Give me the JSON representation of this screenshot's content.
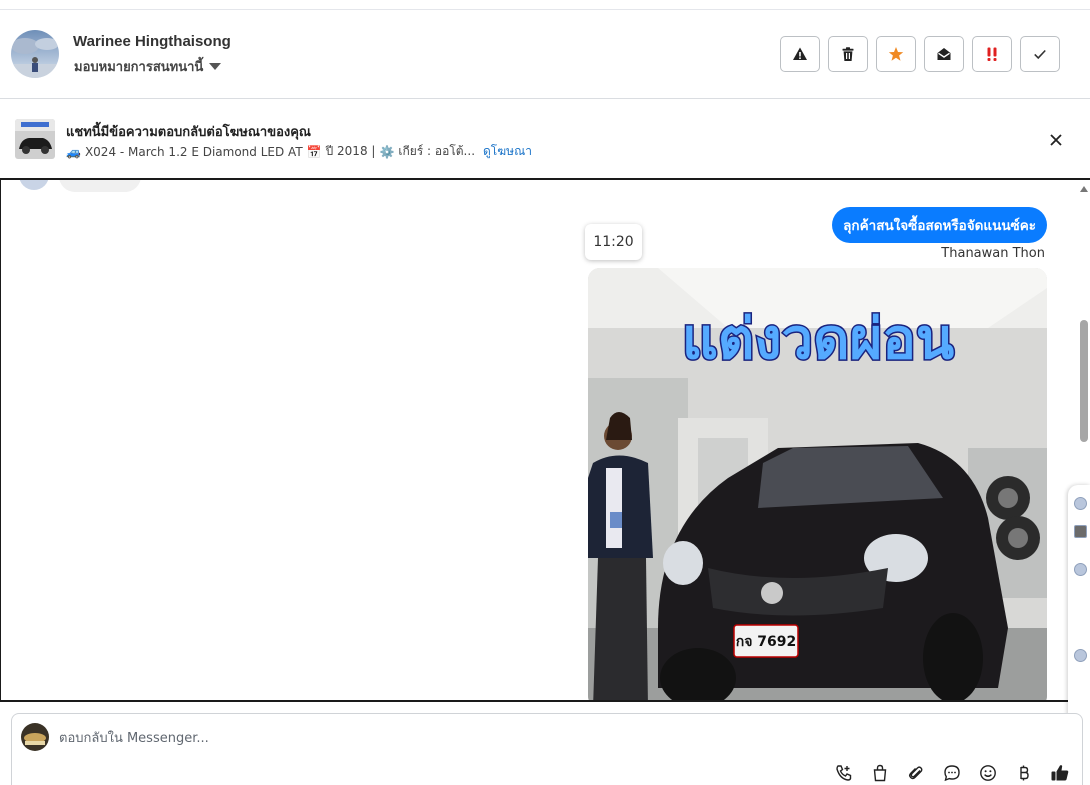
{
  "header": {
    "contact_name": "Warinee Hingthaisong",
    "assign_label": "มอบหมายการสนทนานี้",
    "actions": [
      {
        "name": "report-button",
        "icon": "warning-icon"
      },
      {
        "name": "delete-button",
        "icon": "trash-icon"
      },
      {
        "name": "star-button",
        "icon": "star-icon"
      },
      {
        "name": "mark-unread-button",
        "icon": "envelope-open-icon"
      },
      {
        "name": "important-button",
        "icon": "double-exclamation-icon"
      },
      {
        "name": "done-button",
        "icon": "check-icon"
      }
    ]
  },
  "ad_bar": {
    "title": "แชทนี้มีข้อความตอบกลับต่อโฆษณาของคุณ",
    "detail": "X024 - March 1.2 E Diamond LED AT",
    "year": "ปี 2018 |",
    "gear": "เกียร์ : ออโต้...",
    "link_label": "ดูโฆษณา"
  },
  "chat": {
    "message_text": "ลุกค้าสนใจซื้อสดหรือจัดแนนซ์คะ",
    "sender": "Thanawan Thon",
    "time": "11:20",
    "image_caption": "แต่งวดผ่อน",
    "plate": "กจ 7692"
  },
  "composer": {
    "placeholder": "ตอบกลับใน Messenger..."
  },
  "colors": {
    "accent": "#0a7cff",
    "star": "#f08a24",
    "important": "#e02020",
    "link": "#1a73c8"
  }
}
